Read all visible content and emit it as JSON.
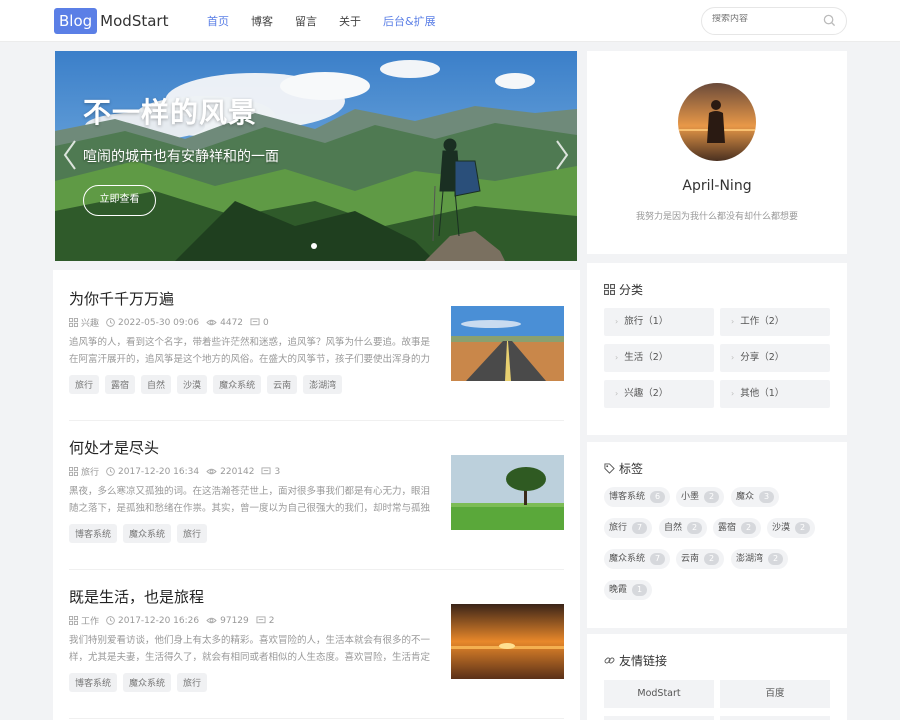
{
  "header": {
    "logo_box": "Blog",
    "logo_text": "ModStart",
    "nav": [
      "首页",
      "博客",
      "留言",
      "关于",
      "后台&扩展"
    ],
    "search_placeholder": "搜索内容"
  },
  "banner": {
    "title": "不一样的风景",
    "subtitle": "喧闹的城市也有安静祥和的一面",
    "button": "立即查看"
  },
  "posts": [
    {
      "title": "为你千千万万遍",
      "category": "兴趣",
      "date": "2022-05-30 09:06",
      "views": "4472",
      "comments": "0",
      "excerpt": "追风筝的人，看到这个名字，带着些许茫然和迷惑，追风筝？风筝为什么要追。故事是在阿富汗展开的，追风筝是这个地方的风俗。在盛大的风筝节，孩子们要使出浑身的力量使自己",
      "tags": [
        "旅行",
        "露宿",
        "自然",
        "沙漠",
        "魔众系统",
        "云南",
        "澎湖湾"
      ]
    },
    {
      "title": "何处才是尽头",
      "category": "旅行",
      "date": "2017-12-20 16:34",
      "views": "220142",
      "comments": "3",
      "excerpt": "黑夜，多么寒凉又孤独的词。在这浩瀚苍茫世上，面对很多事我们都是有心无力，眼泪随之落下，是孤独和愁绪在作祟。其实，曾一度以为自己很强大的我们，却时常与孤独并肩，挣",
      "tags": [
        "博客系统",
        "魔众系统",
        "旅行"
      ]
    },
    {
      "title": "既是生活，也是旅程",
      "category": "工作",
      "date": "2017-12-20 16:26",
      "views": "97129",
      "comments": "2",
      "excerpt": "我们特别爱看访谈，他们身上有太多的精彩。喜欢冒险的人，生活本就会有很多的不一样，尤其是夫妻，生活得久了，就会有相同或者相似的人生态度。喜欢冒险，生活肯定不会波澜",
      "tags": [
        "博客系统",
        "魔众系统",
        "旅行"
      ]
    }
  ],
  "profile": {
    "name": "April-Ning",
    "bio": "我努力是因为我什么都没有却什么都想要"
  },
  "categories": {
    "title": "分类",
    "items": [
      "旅行（1）",
      "工作（2）",
      "生活（2）",
      "分享（2）",
      "兴趣（2）",
      "其他（1）"
    ]
  },
  "tags": {
    "title": "标签",
    "items": [
      {
        "name": "博客系统",
        "count": "6"
      },
      {
        "name": "小墨",
        "count": "2"
      },
      {
        "name": "魔众",
        "count": "3"
      },
      {
        "name": "旅行",
        "count": "7"
      },
      {
        "name": "自然",
        "count": "2"
      },
      {
        "name": "露宿",
        "count": "2"
      },
      {
        "name": "沙漠",
        "count": "2"
      },
      {
        "name": "魔众系统",
        "count": "7"
      },
      {
        "name": "云南",
        "count": "2"
      },
      {
        "name": "澎湖湾",
        "count": "2"
      },
      {
        "name": "晚霞",
        "count": "1"
      }
    ]
  },
  "links": {
    "title": "友情链接",
    "items": [
      "ModStart",
      "百度"
    ]
  },
  "colors": {
    "accent": "#5b7fe6",
    "background": "#f2f3f5"
  }
}
